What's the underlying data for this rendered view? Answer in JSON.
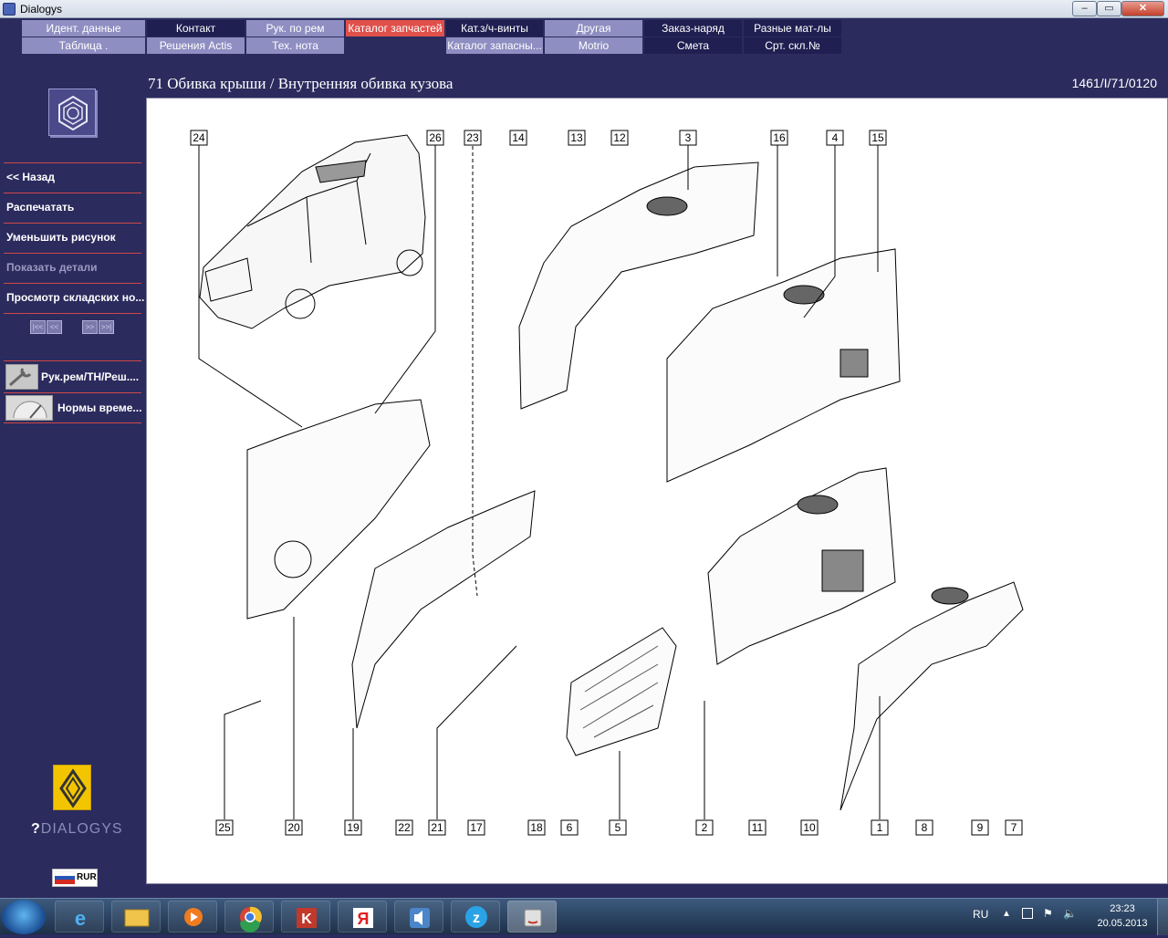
{
  "window": {
    "title": "Dialogys"
  },
  "menu": {
    "row1": [
      {
        "label": "Идент. данные"
      },
      {
        "label": "Контакт"
      },
      {
        "label": "Рук. по рем"
      },
      {
        "label": "Каталог запчастей"
      },
      {
        "label": "Кат.з/ч-винты"
      },
      {
        "label": "Другая"
      },
      {
        "label": "Заказ-наряд"
      },
      {
        "label": "Разные мат-лы"
      }
    ],
    "row2": [
      {
        "label": "Таблица ."
      },
      {
        "label": "Решения Actis"
      },
      {
        "label": "Тех. нота"
      },
      {
        "label": "Каталог запасны..."
      },
      {
        "label": "Motrio"
      },
      {
        "label": "Смета"
      },
      {
        "label": "Срт. скл.№"
      }
    ],
    "active": "Каталог запчастей"
  },
  "header": {
    "title": "71 Обивка крыши / Внутренняя обивка кузова",
    "code": "1461/I/71/0120"
  },
  "sidebar": {
    "items": [
      {
        "label": "<< Назад"
      },
      {
        "label": "Распечатать"
      },
      {
        "label": "Уменьшить рисунок"
      },
      {
        "label": "Показать детали"
      },
      {
        "label": "Просмотр складских но..."
      }
    ],
    "nav": [
      "|<<",
      "<<",
      ">>",
      ">>|"
    ],
    "links": [
      {
        "label": "Рук.рем/ТН/Реш...."
      },
      {
        "label": "Нормы време..."
      }
    ],
    "brand": "DIALOGYS",
    "language": "RUR"
  },
  "diagram": {
    "top_callouts": [
      "24",
      "26",
      "23",
      "14",
      "13",
      "12",
      "3",
      "16",
      "4",
      "15"
    ],
    "bottom_callouts": [
      "25",
      "20",
      "19",
      "22",
      "21",
      "17",
      "18",
      "6",
      "5",
      "2",
      "11",
      "10",
      "1",
      "8",
      "9",
      "7"
    ]
  },
  "taskbar": {
    "apps": [
      "ie-icon",
      "explorer-icon",
      "media-player-icon",
      "chrome-icon",
      "kaspersky-icon",
      "yandex-icon",
      "volume-app-icon",
      "z-app-icon",
      "java-app-icon"
    ],
    "tray": {
      "language": "RU",
      "time": "23:23",
      "date": "20.05.2013"
    }
  },
  "colors": {
    "app_bg": "#2b2b5e",
    "menu_active": "#e0504b",
    "menu_light": "#8e8ec2",
    "menu_dark": "#1f1f52",
    "separator": "#d04848"
  }
}
